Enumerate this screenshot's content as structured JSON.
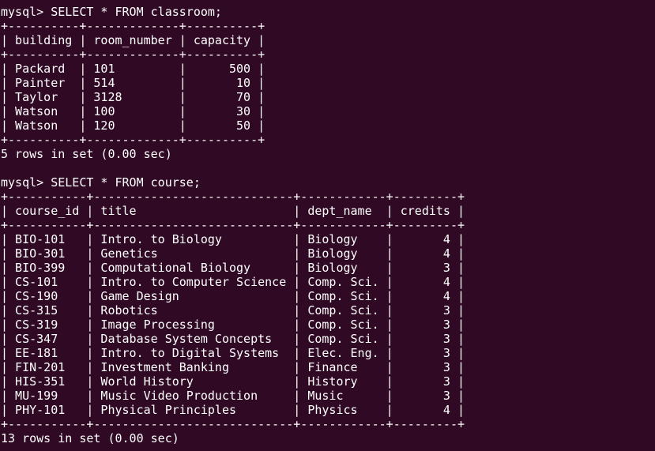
{
  "terminal": {
    "lines": [
      "mysql> SELECT * FROM classroom;",
      "+----------+-------------+----------+",
      "| building | room_number | capacity |",
      "+----------+-------------+----------+",
      "| Packard  | 101         |      500 |",
      "| Painter  | 514         |       10 |",
      "| Taylor   | 3128        |       70 |",
      "| Watson   | 100         |       30 |",
      "| Watson   | 120         |       50 |",
      "+----------+-------------+----------+",
      "5 rows in set (0.00 sec)",
      "",
      "mysql> SELECT * FROM course;",
      "+-----------+----------------------------+------------+---------+",
      "| course_id | title                      | dept_name  | credits |",
      "+-----------+----------------------------+------------+---------+",
      "| BIO-101   | Intro. to Biology          | Biology    |       4 |",
      "| BIO-301   | Genetics                   | Biology    |       4 |",
      "| BIO-399   | Computational Biology      | Biology    |       3 |",
      "| CS-101    | Intro. to Computer Science | Comp. Sci. |       4 |",
      "| CS-190    | Game Design                | Comp. Sci. |       4 |",
      "| CS-315    | Robotics                   | Comp. Sci. |       3 |",
      "| CS-319    | Image Processing           | Comp. Sci. |       3 |",
      "| CS-347    | Database System Concepts   | Comp. Sci. |       3 |",
      "| EE-181    | Intro. to Digital Systems  | Elec. Eng. |       3 |",
      "| FIN-201   | Investment Banking         | Finance    |       3 |",
      "| HIS-351   | World History              | History    |       3 |",
      "| MU-199    | Music Video Production     | Music      |       3 |",
      "| PHY-101   | Physical Principles        | Physics    |       4 |",
      "+-----------+----------------------------+------------+---------+",
      "13 rows in set (0.00 sec)"
    ]
  },
  "colors": {
    "background": "#300a24",
    "foreground": "#ffffff"
  }
}
